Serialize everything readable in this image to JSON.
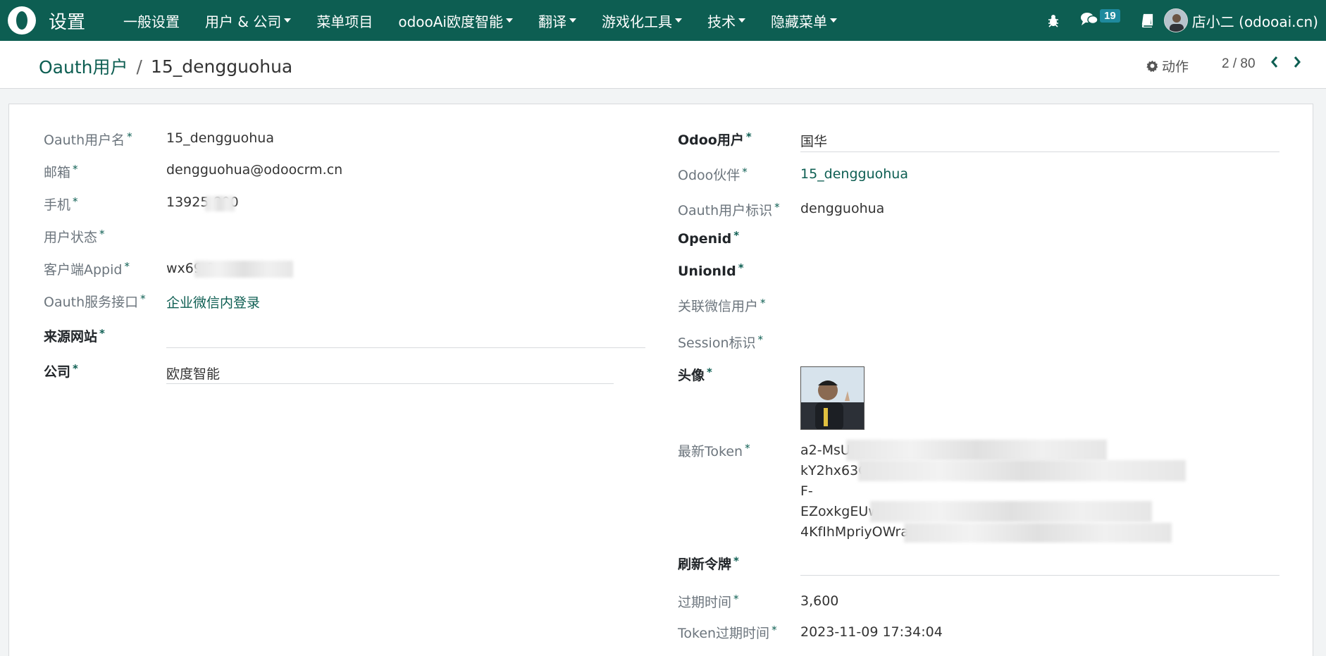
{
  "navbar": {
    "app_name": "设置",
    "menu": [
      {
        "label": "一般设置",
        "dropdown": false
      },
      {
        "label": "用户 & 公司",
        "dropdown": true
      },
      {
        "label": "菜单项目",
        "dropdown": false
      },
      {
        "label": "odooAi欧度智能",
        "dropdown": true
      },
      {
        "label": "翻译",
        "dropdown": true
      },
      {
        "label": "游戏化工具",
        "dropdown": true
      },
      {
        "label": "技术",
        "dropdown": true
      },
      {
        "label": "隐藏菜单",
        "dropdown": true
      }
    ],
    "message_count": "19",
    "user_name": "店小二 (odooai.cn)",
    "bg_color": "#0d5e52"
  },
  "control": {
    "breadcrumb_parent": "Oauth用户",
    "breadcrumb_sep": "/",
    "breadcrumb_current": "15_dengguohua",
    "actions_label": "动作",
    "pager": "2 / 80"
  },
  "form": {
    "left": [
      {
        "label": "Oauth用户名",
        "value": "15_dengguohua"
      },
      {
        "label": "邮箱",
        "value": "dengguohua@odoocrm.cn"
      },
      {
        "label": "手机",
        "value": "13925   800"
      },
      {
        "label": "用户状态",
        "value": ""
      },
      {
        "label": "客户端Appid",
        "value": "wx69            2a"
      },
      {
        "label": "Oauth服务接口",
        "value": "企业微信内登录"
      },
      {
        "label": "来源网站",
        "value": ""
      },
      {
        "label": "公司",
        "value": "欧度智能"
      }
    ],
    "right": [
      {
        "label": "Odoo用户",
        "value": "国华"
      },
      {
        "label": "Odoo伙伴",
        "value": "15_dengguohua"
      },
      {
        "label": "Oauth用户标识",
        "value": "dengguohua"
      },
      {
        "label": "Openid",
        "value": ""
      },
      {
        "label": "UnionId",
        "value": ""
      },
      {
        "label": "关联微信用户",
        "value": ""
      },
      {
        "label": "Session标识",
        "value": ""
      },
      {
        "label": "头像",
        "value": ""
      },
      {
        "label": "最新Token",
        "value": ""
      },
      {
        "label": "刷新令牌",
        "value": ""
      },
      {
        "label": "过期时间",
        "value": "3,600"
      },
      {
        "label": "Token过期时间",
        "value": "2023-11-09 17:34:04"
      }
    ],
    "token_lines": [
      "a2-MsU                                   21Y-",
      "kY2hx63C8                                                        74BsIR3lnWbSHw",
      "F-",
      "EZoxkgEUwzh                                                 SO_Pv    TUcOxjdamD",
      "4KfIhMpriyOWraENU"
    ]
  }
}
